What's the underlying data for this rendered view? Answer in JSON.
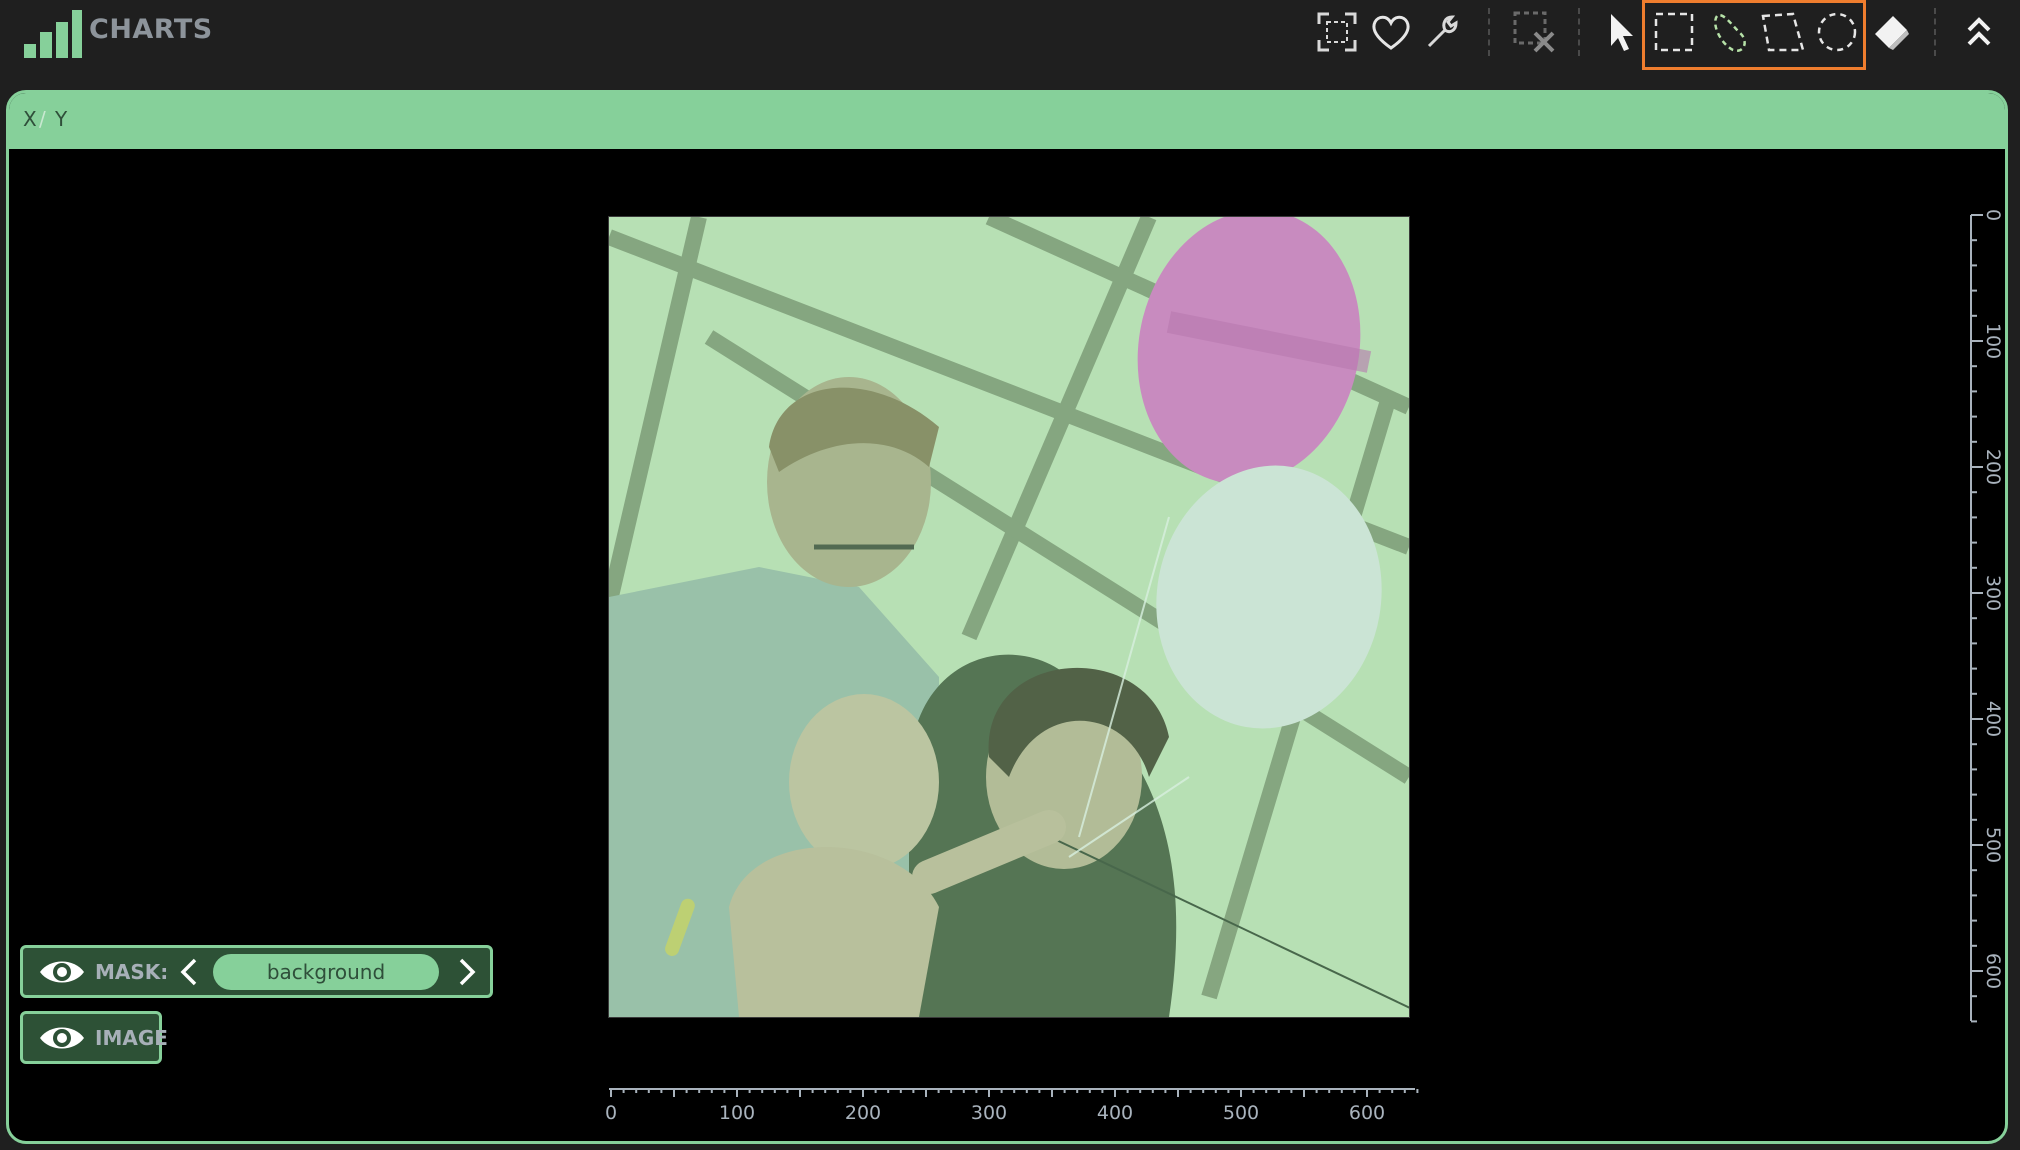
{
  "app": {
    "title": "CHARTS"
  },
  "toolbar": {
    "icons": [
      "expand-icon",
      "heart-icon",
      "wrench-icon",
      "clear-selection-icon",
      "pointer-icon",
      "rectangle-select-icon",
      "lasso-select-icon",
      "polygon-select-icon",
      "ellipse-select-icon",
      "brush-icon",
      "collapse-icon"
    ],
    "highlight_color": "#ef7d2e"
  },
  "panel": {
    "x_label": "X",
    "separator": "/",
    "y_label": "Y",
    "accent_color": "#86d09a"
  },
  "y_axis": {
    "ticks": [
      "0",
      "100",
      "200",
      "300",
      "400",
      "500",
      "600"
    ]
  },
  "x_axis": {
    "ticks": [
      "0",
      "100",
      "200",
      "300",
      "400",
      "500",
      "600"
    ]
  },
  "mask": {
    "label": "MASK:",
    "value": "background"
  },
  "image_toggle": {
    "label": "IMAGE"
  }
}
